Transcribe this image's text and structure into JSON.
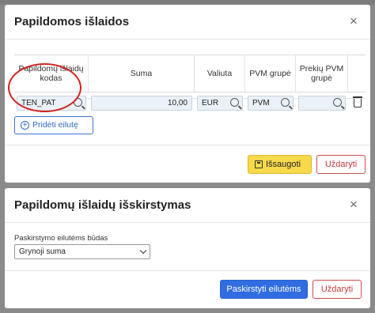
{
  "dialog_expenses": {
    "title": "Papildomos išlaidos",
    "close_symbol": "×",
    "columns": [
      "Papildomų išlaidų kodas",
      "Suma",
      "Valiuta",
      "PVM grupė",
      "Prekių PVM grupė"
    ],
    "row": {
      "code": "TEN_PAT",
      "amount": "10,00",
      "currency": "EUR",
      "vat_group": "PVM",
      "goods_vat_group": ""
    },
    "add_row_label": "Pridėti eilutę",
    "save_label": "Išsaugoti",
    "close_label": "Uždaryti"
  },
  "dialog_distribution": {
    "title": "Papildomų išlaidų išskirstymas",
    "close_symbol": "×",
    "field_label": "Paskirstymo eilutėms būdas",
    "method_value": "Grynoji suma",
    "distribute_label": "Paskirstyti eilutėms",
    "close_label": "Uždaryti"
  },
  "colors": {
    "primary": "#2f6de0",
    "save": "#f7d94c",
    "danger": "#c43a3a",
    "annotation": "#d0231f"
  }
}
